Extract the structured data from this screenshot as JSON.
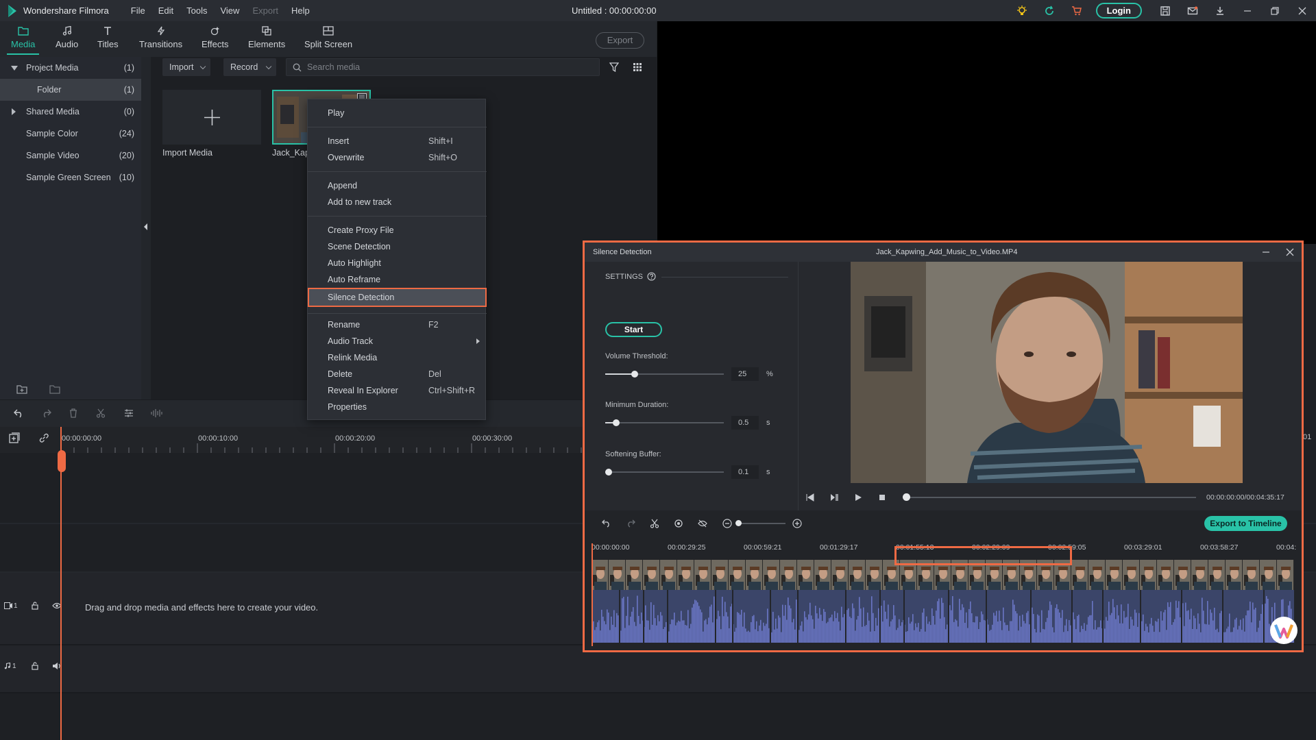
{
  "titlebar": {
    "app_name": "Wondershare Filmora",
    "menus": [
      "File",
      "Edit",
      "Tools",
      "View",
      "Export",
      "Help"
    ],
    "window_title": "Untitled : 00:00:00:00",
    "login_label": "Login"
  },
  "toolbar": {
    "tabs": [
      {
        "label": "Media",
        "icon": "media-folder-icon"
      },
      {
        "label": "Audio",
        "icon": "music-note-icon"
      },
      {
        "label": "Titles",
        "icon": "text-T-icon"
      },
      {
        "label": "Transitions",
        "icon": "transition-icon"
      },
      {
        "label": "Effects",
        "icon": "effects-icon"
      },
      {
        "label": "Elements",
        "icon": "elements-icon"
      },
      {
        "label": "Split Screen",
        "icon": "split-screen-icon"
      }
    ],
    "active_tab": "Media",
    "export_label": "Export"
  },
  "left_panel": {
    "items": [
      {
        "name": "Project Media",
        "count": "(1)"
      },
      {
        "name": "Folder",
        "count": "(1)"
      },
      {
        "name": "Shared Media",
        "count": "(0)"
      },
      {
        "name": "Sample Color",
        "count": "(24)"
      },
      {
        "name": "Sample Video",
        "count": "(20)"
      },
      {
        "name": "Sample Green Screen",
        "count": "(10)"
      }
    ]
  },
  "media": {
    "import_label": "Import",
    "record_label": "Record",
    "search_placeholder": "Search media",
    "import_tile_label": "Import Media",
    "clip_label": "Jack_Kap"
  },
  "context_menu": {
    "items": [
      {
        "label": "Play",
        "shortcut": ""
      },
      {
        "label": "Insert",
        "shortcut": "Shift+I"
      },
      {
        "label": "Overwrite",
        "shortcut": "Shift+O"
      },
      {
        "label": "Append",
        "shortcut": ""
      },
      {
        "label": "Add to new track",
        "shortcut": ""
      },
      {
        "label": "Create Proxy File",
        "shortcut": ""
      },
      {
        "label": "Scene Detection",
        "shortcut": ""
      },
      {
        "label": "Auto Highlight",
        "shortcut": ""
      },
      {
        "label": "Auto Reframe",
        "shortcut": ""
      },
      {
        "label": "Silence Detection",
        "shortcut": ""
      },
      {
        "label": "Rename",
        "shortcut": "F2"
      },
      {
        "label": "Audio Track",
        "shortcut": ""
      },
      {
        "label": "Relink Media",
        "shortcut": ""
      },
      {
        "label": "Delete",
        "shortcut": "Del"
      },
      {
        "label": "Reveal In Explorer",
        "shortcut": "Ctrl+Shift+R"
      },
      {
        "label": "Properties",
        "shortcut": ""
      }
    ],
    "highlighted": "Silence Detection"
  },
  "timeline": {
    "ruler_ticks": [
      "00:00:00:00",
      "00:00:10:00",
      "00:00:20:00",
      "00:00:30:00"
    ],
    "right_edge_tick": ":01",
    "drop_message": "Drag and drop media and effects here to create your video.",
    "video_track_label": "1",
    "audio_track_label": "1"
  },
  "dialog": {
    "title": "Silence Detection",
    "file_name": "Jack_Kapwing_Add_Music_to_Video.MP4",
    "settings_label": "SETTINGS",
    "start_label": "Start",
    "volume_threshold": {
      "label": "Volume Threshold:",
      "value": "25",
      "unit": "%",
      "fraction": 0.25
    },
    "minimum_duration": {
      "label": "Minimum Duration:",
      "value": "0.5",
      "unit": "s",
      "fraction": 0.09
    },
    "softening_buffer": {
      "label": "Softening Buffer:",
      "value": "0.1",
      "unit": "s",
      "fraction": 0.03
    },
    "playback_time": "00:00:00:00/00:04:35:17",
    "export_to_timeline_label": "Export to Timeline",
    "timeline_ticks": [
      "00:00:00:00",
      "00:00:29:25",
      "00:00:59:21",
      "00:01:29:17",
      "00:01:55:13",
      "00:02:29:09",
      "00:02:59:05",
      "00:03:29:01",
      "00:03:58:27",
      "00:04:"
    ]
  },
  "colors": {
    "accent": "#29c2a7",
    "highlight": "#ef6a44",
    "waveform": "#6a76c4"
  }
}
